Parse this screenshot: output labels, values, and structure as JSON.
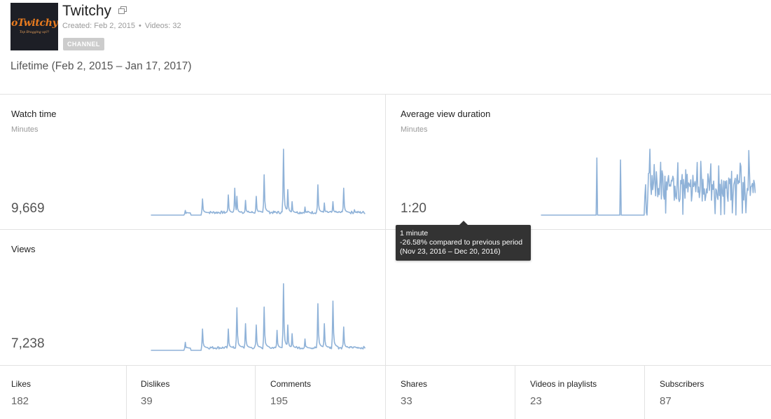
{
  "channel": {
    "logo_text": "oTwitchy",
    "logo_subtext": "Top Bragging up?!",
    "name": "Twitchy",
    "created": "Created: Feb 2, 2015",
    "separator": "•",
    "videos": "Videos: 32",
    "badge": "CHANNEL",
    "date_range": "Lifetime (Feb 2, 2015 – Jan 17, 2017)"
  },
  "icons": {
    "external_link": "external-link-icon"
  },
  "colors": {
    "sparkline": "#8fb2d8",
    "tooltip_bg": "#333333",
    "divider": "#e2e2e2"
  },
  "metrics": {
    "watch_time": {
      "title": "Watch time",
      "unit": "Minutes",
      "value": "9,669"
    },
    "avg_view_duration": {
      "title": "Average view duration",
      "unit": "Minutes",
      "value": "1:20"
    },
    "views": {
      "title": "Views",
      "unit": "",
      "value": "7,238"
    }
  },
  "tooltip": {
    "line1": "1 minute",
    "line2": "-26.58% compared to previous period",
    "line3": "(Nov 23, 2016 – Dec 20, 2016)"
  },
  "stats": [
    {
      "label": "Likes",
      "value": "182"
    },
    {
      "label": "Dislikes",
      "value": "39"
    },
    {
      "label": "Comments",
      "value": "195"
    },
    {
      "label": "Shares",
      "value": "33"
    },
    {
      "label": "Videos in playlists",
      "value": "23"
    },
    {
      "label": "Subscribers",
      "value": "87"
    }
  ]
}
